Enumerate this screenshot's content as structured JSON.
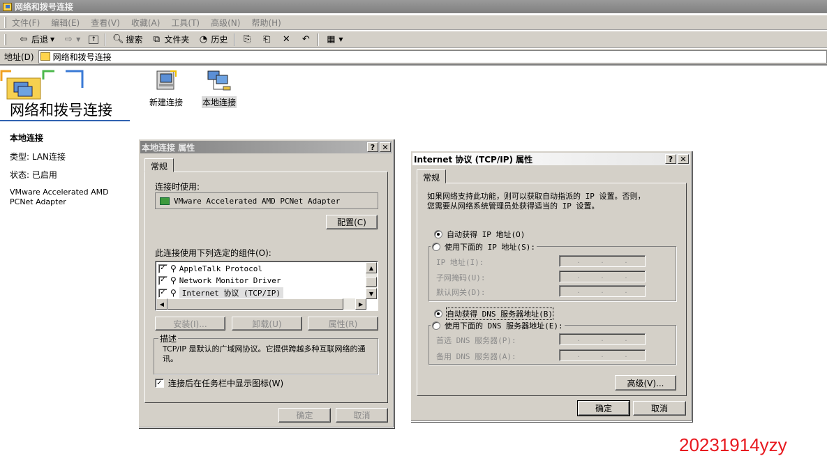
{
  "window": {
    "title": "网络和拨号连接",
    "menu": [
      "文件(F)",
      "编辑(E)",
      "查看(V)",
      "收藏(A)",
      "工具(T)",
      "高级(N)",
      "帮助(H)"
    ],
    "toolbar": {
      "back": "后退",
      "search": "搜索",
      "folders": "文件夹",
      "history": "历史"
    },
    "address_label": "地址(D)",
    "address_value": "网络和拨号连接"
  },
  "left_pane": {
    "title": "网络和拨号连接",
    "selected_name": "本地连接",
    "type": "类型: LAN连接",
    "status": "状态: 已启用",
    "adapter": "VMware Accelerated AMD PCNet Adapter"
  },
  "icons": {
    "new_connection": "新建连接",
    "local_connection": "本地连接"
  },
  "local_props": {
    "title": "本地连接 属性",
    "help_btn": "?",
    "close_btn": "✕",
    "tab": "常规",
    "connect_using_label": "连接时使用:",
    "adapter": "VMware Accelerated AMD PCNet Adapter",
    "configure_btn": "配置(C)",
    "components_label": "此连接使用下列选定的组件(O):",
    "components": [
      "AppleTalk Protocol",
      "Network Monitor Driver",
      "Internet 协议 (TCP/IP)"
    ],
    "install_btn": "安装(I)...",
    "uninstall_btn": "卸载(U)",
    "properties_btn": "属性(R)",
    "description_legend": "描述",
    "description": "TCP/IP 是默认的广域网协议。它提供跨越多种互联网络的通讯。",
    "show_icon_label": "连接后在任务栏中显示图标(W)",
    "ok_btn": "确定",
    "cancel_btn": "取消"
  },
  "tcpip_props": {
    "title": "Internet 协议 (TCP/IP) 属性",
    "help_btn": "?",
    "close_btn": "✕",
    "tab": "常规",
    "intro_line1": "如果网络支持此功能，则可以获取自动指派的 IP 设置。否则，",
    "intro_line2": "您需要从网络系统管理员处获得适当的 IP 设置。",
    "auto_ip": "自动获得 IP 地址(O)",
    "manual_ip": "使用下面的 IP 地址(S):",
    "ip_label": "IP 地址(I):",
    "mask_label": "子网掩码(U):",
    "gateway_label": "默认网关(D):",
    "auto_dns": "自动获得 DNS 服务器地址(B)",
    "manual_dns": "使用下面的 DNS 服务器地址(E):",
    "pref_dns_label": "首选 DNS 服务器(P):",
    "alt_dns_label": "备用 DNS 服务器(A):",
    "advanced_btn": "高级(V)...",
    "ok_btn": "确定",
    "cancel_btn": "取消"
  },
  "watermark": "20231914yzy"
}
